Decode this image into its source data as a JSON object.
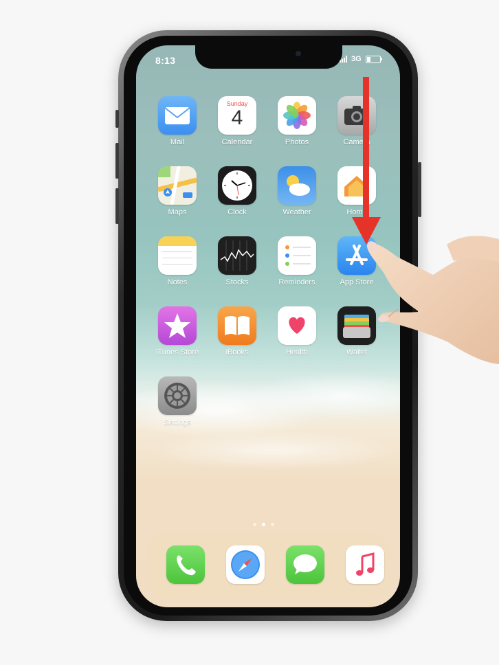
{
  "status_bar": {
    "time": "8:13",
    "network": "3G"
  },
  "calendar": {
    "weekday": "Sunday",
    "day": "4"
  },
  "apps": [
    {
      "label": "Mail",
      "icon": "mail-icon"
    },
    {
      "label": "Calendar",
      "icon": "calendar-icon"
    },
    {
      "label": "Photos",
      "icon": "photos-icon"
    },
    {
      "label": "Camera",
      "icon": "camera-icon"
    },
    {
      "label": "Maps",
      "icon": "maps-icon"
    },
    {
      "label": "Clock",
      "icon": "clock-icon"
    },
    {
      "label": "Weather",
      "icon": "weather-icon"
    },
    {
      "label": "Home",
      "icon": "home-icon"
    },
    {
      "label": "Notes",
      "icon": "notes-icon"
    },
    {
      "label": "Stocks",
      "icon": "stocks-icon"
    },
    {
      "label": "Reminders",
      "icon": "reminders-icon"
    },
    {
      "label": "App Store",
      "icon": "app-store-icon"
    },
    {
      "label": "iTunes Store",
      "icon": "itunes-store-icon"
    },
    {
      "label": "iBooks",
      "icon": "ibooks-icon"
    },
    {
      "label": "Health",
      "icon": "health-icon"
    },
    {
      "label": "Wallet",
      "icon": "wallet-icon"
    },
    {
      "label": "Settings",
      "icon": "settings-icon"
    }
  ],
  "dock": [
    {
      "icon": "phone-icon"
    },
    {
      "icon": "safari-icon"
    },
    {
      "icon": "messages-icon"
    },
    {
      "icon": "music-icon"
    }
  ],
  "page_indicator": {
    "count": 3,
    "active": 2
  },
  "gesture": {
    "direction": "down",
    "arrow_color": "#e6332a"
  }
}
